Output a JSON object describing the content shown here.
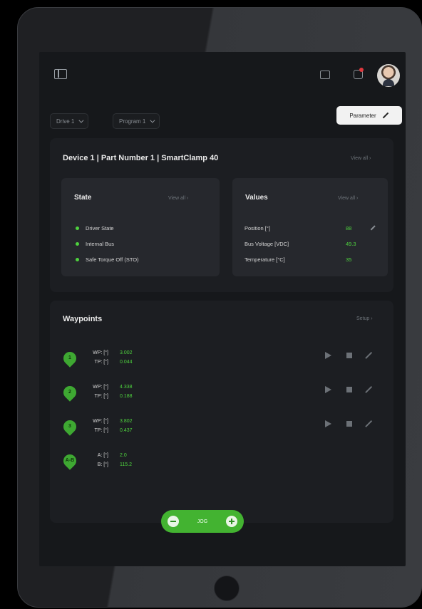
{
  "toolbar": {
    "drive_select": "Drive 1",
    "program_select": "Program 1",
    "parameter_label": "Parameter"
  },
  "device": {
    "title": "Device 1 | Part Number 1 | SmartClamp 40",
    "view_all": "View all",
    "state": {
      "title": "State",
      "view_all": "View all",
      "items": [
        "Driver State",
        "Internal Bus",
        "Safe Torque Off (STO)"
      ]
    },
    "values": {
      "title": "Values",
      "view_all": "View all",
      "rows": [
        {
          "label": "Position [°]",
          "value": "88"
        },
        {
          "label": "Bus Voltage [VDC]",
          "value": "49.3"
        },
        {
          "label": "Temperature [°C]",
          "value": "35"
        }
      ]
    }
  },
  "waypoints": {
    "title": "Waypoints",
    "setup": "Setup",
    "items": [
      {
        "marker": "1",
        "l1": "WP: [°]",
        "v1": "3.002",
        "l2": "TP: [°]",
        "v2": "0.044"
      },
      {
        "marker": "2",
        "l1": "WP: [°]",
        "v1": "4.338",
        "l2": "TP: [°]",
        "v2": "0.188"
      },
      {
        "marker": "3",
        "l1": "WP: [°]",
        "v1": "3.802",
        "l2": "TP: [°]",
        "v2": "0.437"
      },
      {
        "marker": "A-B",
        "l1": "A: [°]",
        "v1": "2.0",
        "l2": "B: [°]",
        "v2": "115.2"
      }
    ]
  },
  "jog": {
    "label": "JOG"
  },
  "colors": {
    "accent": "#43b331",
    "status_ok": "#4ed23e",
    "background": "#16181b"
  }
}
